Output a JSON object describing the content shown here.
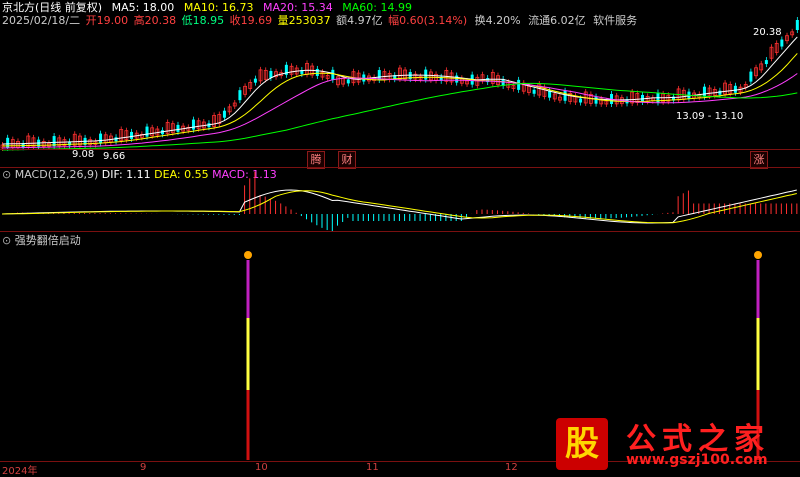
{
  "header": {
    "title": "京北方(日线 前复权)",
    "ma5": "MA5: 18.00",
    "ma10": "MA10: 16.73",
    "ma20": "MA20: 15.34",
    "ma60": "MA60: 14.99"
  },
  "info": {
    "date": "2025/02/18/二",
    "open": "开19.00",
    "high": "高20.38",
    "low": "低18.95",
    "close": "收19.69",
    "volume": "量253037",
    "amount": "额4.97亿",
    "change": "幅0.60(3.14%)",
    "turnover": "换4.20%",
    "float": "流通6.02亿",
    "industry": "软件服务"
  },
  "price_chart": {
    "high_label": "20.38",
    "low_label1": "9.08",
    "low_label2": "9.66",
    "range_label": "13.09 - 13.10",
    "markers": [
      "腾",
      "财",
      "涨"
    ]
  },
  "macd": {
    "name": "MACD(12,26,9)",
    "dif": "DIF: 1.11",
    "dea": "DEA: 0.55",
    "macd": "MACD: 1.13"
  },
  "indicator": {
    "name": "强势翻倍启动"
  },
  "x_axis": {
    "labels": [
      "2024年",
      "9",
      "10",
      "11",
      "12"
    ]
  },
  "watermark": {
    "gu": "股",
    "title": "公式之家",
    "url": "www.gszj100.com"
  },
  "colors": {
    "ma5": "#ffffff",
    "ma10": "#ffff00",
    "ma20": "#ff40ff",
    "ma60": "#00ff00",
    "up": "#ff3030",
    "down": "#00ffff"
  }
}
